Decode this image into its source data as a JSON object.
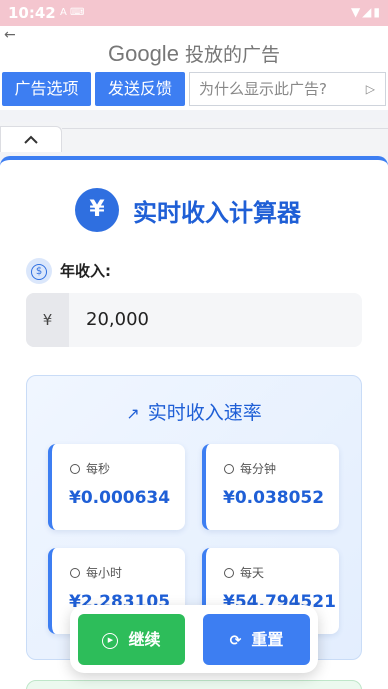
{
  "status_bar": {
    "time": "10:42",
    "left_icons": "A ⌨",
    "right_icons": "▼◢▮"
  },
  "ad": {
    "back": "←",
    "brand": "Google",
    "title_suffix": "投放的广告",
    "btn_options": "广告选项",
    "btn_feedback": "发送反馈",
    "why_text": "为什么显示此广告?",
    "why_icon": "▷"
  },
  "collapse": {
    "icon": "chevron-up-icon",
    "glyph": "︿"
  },
  "app": {
    "title_icon": "¥",
    "title": "实时收入计算器",
    "income_icon": "$",
    "income_label": "年收入:",
    "currency_prefix": "¥",
    "income_value": "20,000",
    "rate_title": "实时收入速率",
    "rate_icon": "↗",
    "rates": [
      {
        "label": "每秒",
        "value": "¥0.000634"
      },
      {
        "label": "每分钟",
        "value": "¥0.038052"
      },
      {
        "label": "每小时",
        "value": "¥2.283105"
      },
      {
        "label": "每天",
        "value": "¥54.794521"
      }
    ],
    "continue_label": "继续",
    "continue_icon": "▶",
    "reset_label": "重置",
    "reset_icon": "⟳"
  },
  "colors": {
    "accent": "#3d7ef2",
    "green": "#2dbd5a",
    "status_bar": "#f4c6cf"
  }
}
